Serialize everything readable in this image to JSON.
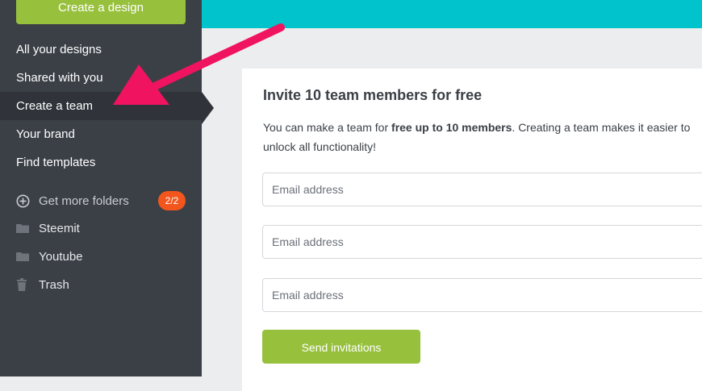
{
  "sidebar": {
    "create_button": "Create a design",
    "nav": [
      {
        "label": "All your designs"
      },
      {
        "label": "Shared with you"
      },
      {
        "label": "Create a team"
      },
      {
        "label": "Your brand"
      },
      {
        "label": "Find templates"
      }
    ],
    "get_more_folders": {
      "label": "Get more folders",
      "badge": "2/2",
      "icon": "plus-circle-icon"
    },
    "folders": [
      {
        "label": "Steemit",
        "icon": "folder-icon"
      },
      {
        "label": "Youtube",
        "icon": "folder-icon"
      },
      {
        "label": "Trash",
        "icon": "trash-icon"
      }
    ]
  },
  "invite": {
    "title": "Invite 10 team members for free",
    "desc_prefix": "You can make a team for ",
    "desc_bold": "free up to 10 members",
    "desc_suffix": ". Creating a team makes it easier to",
    "desc_line2": "unlock all functionality!",
    "email_placeholder": "Email address",
    "send_label": "Send invitations"
  },
  "colors": {
    "accent": "#97c03c",
    "sidebar": "#3b4047",
    "topbar": "#00c3cc",
    "badge": "#f2561d",
    "arrow": "#f0135f"
  }
}
